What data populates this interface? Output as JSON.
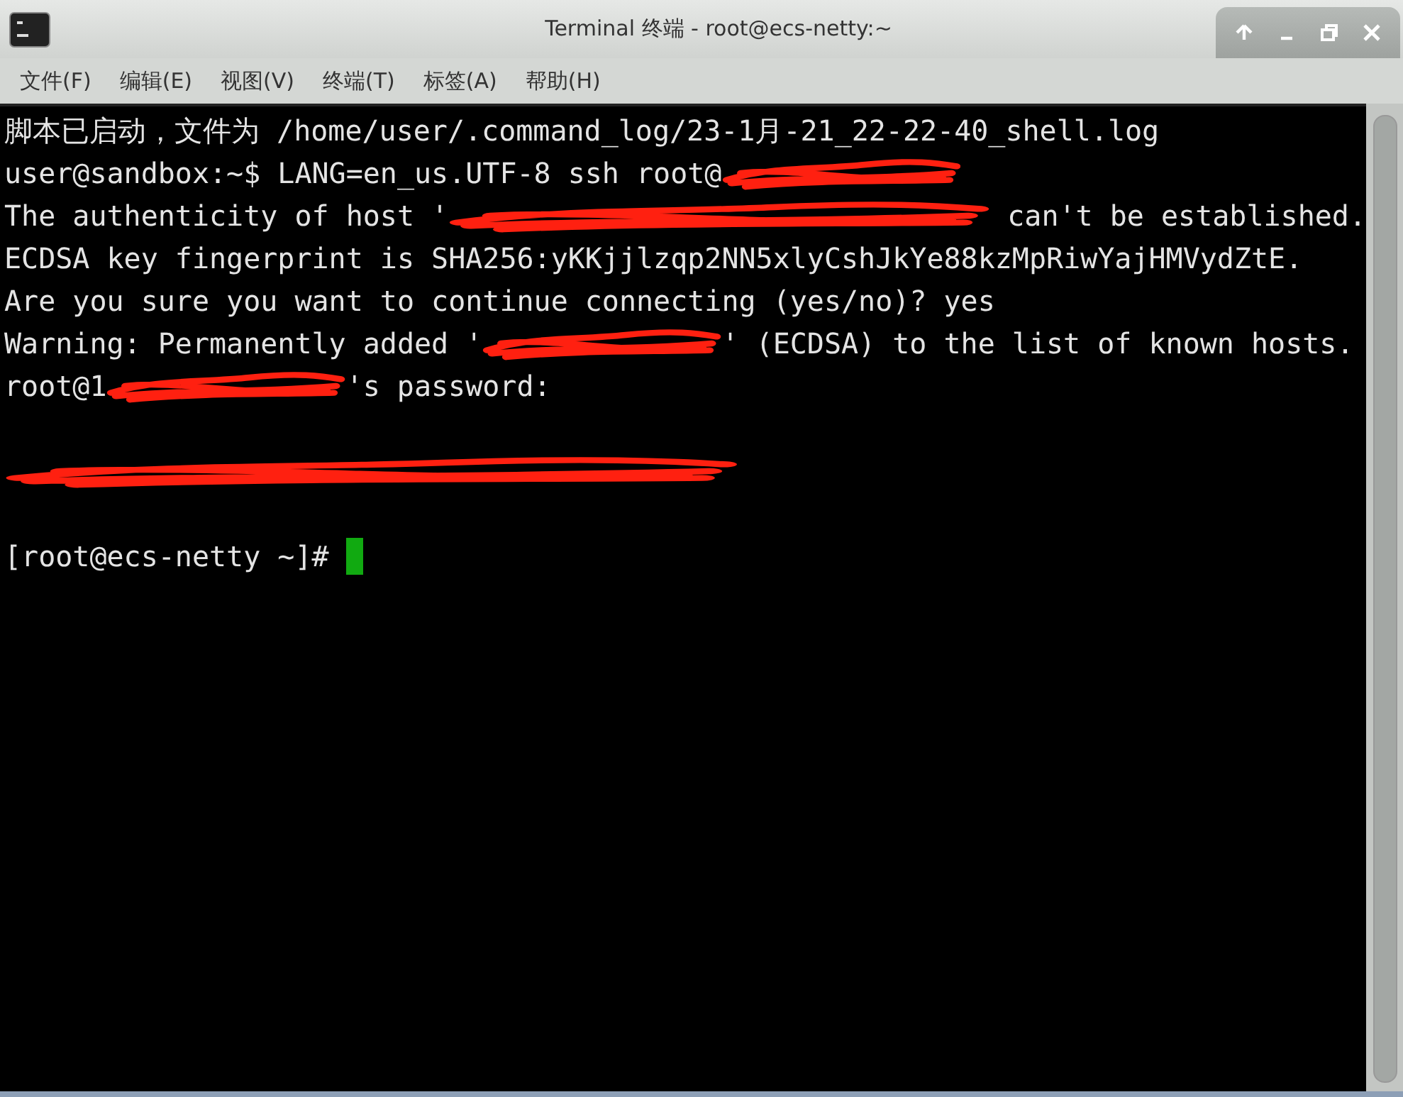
{
  "window": {
    "title": "Terminal 终端 - root@ecs-netty:~"
  },
  "menu": [
    "文件(F)",
    "编辑(E)",
    "视图(V)",
    "终端(T)",
    "标签(A)",
    "帮助(H)"
  ],
  "terminal": {
    "lines": [
      [
        {
          "kind": "text",
          "text": "脚本已启动，文件为 /home/user/.command_log/23-1月-21_22-22-40_shell.log"
        }
      ],
      [
        {
          "kind": "text",
          "text": "user@sandbox:~$ LANG=en_us.UTF-8 ssh root@"
        },
        {
          "kind": "redacted-short"
        }
      ],
      [
        {
          "kind": "text",
          "text": "The authenticity of host '"
        },
        {
          "kind": "redacted-medium"
        },
        {
          "kind": "text",
          "text": " can't be established."
        }
      ],
      [
        {
          "kind": "text",
          "text": "ECDSA key fingerprint is SHA256:yKKjjlzqp2NN5xlyCshJkYe88kzMpRiwYajHMVydZtE."
        }
      ],
      [
        {
          "kind": "text",
          "text": "Are you sure you want to continue connecting (yes/no)? yes"
        }
      ],
      [
        {
          "kind": "text",
          "text": "Warning: Permanently added '"
        },
        {
          "kind": "redacted-short"
        },
        {
          "kind": "text",
          "text": "' (ECDSA) to the list of known hosts."
        }
      ],
      [
        {
          "kind": "text",
          "text": "root@1"
        },
        {
          "kind": "redacted-short"
        },
        {
          "kind": "text",
          "text": "'s password:"
        }
      ],
      [
        {
          "kind": "blank"
        }
      ],
      [
        {
          "kind": "redacted-long"
        }
      ],
      [
        {
          "kind": "blank"
        }
      ],
      [
        {
          "kind": "text",
          "text": "[root@ecs-netty ~]# "
        },
        {
          "kind": "cursor"
        }
      ]
    ]
  }
}
